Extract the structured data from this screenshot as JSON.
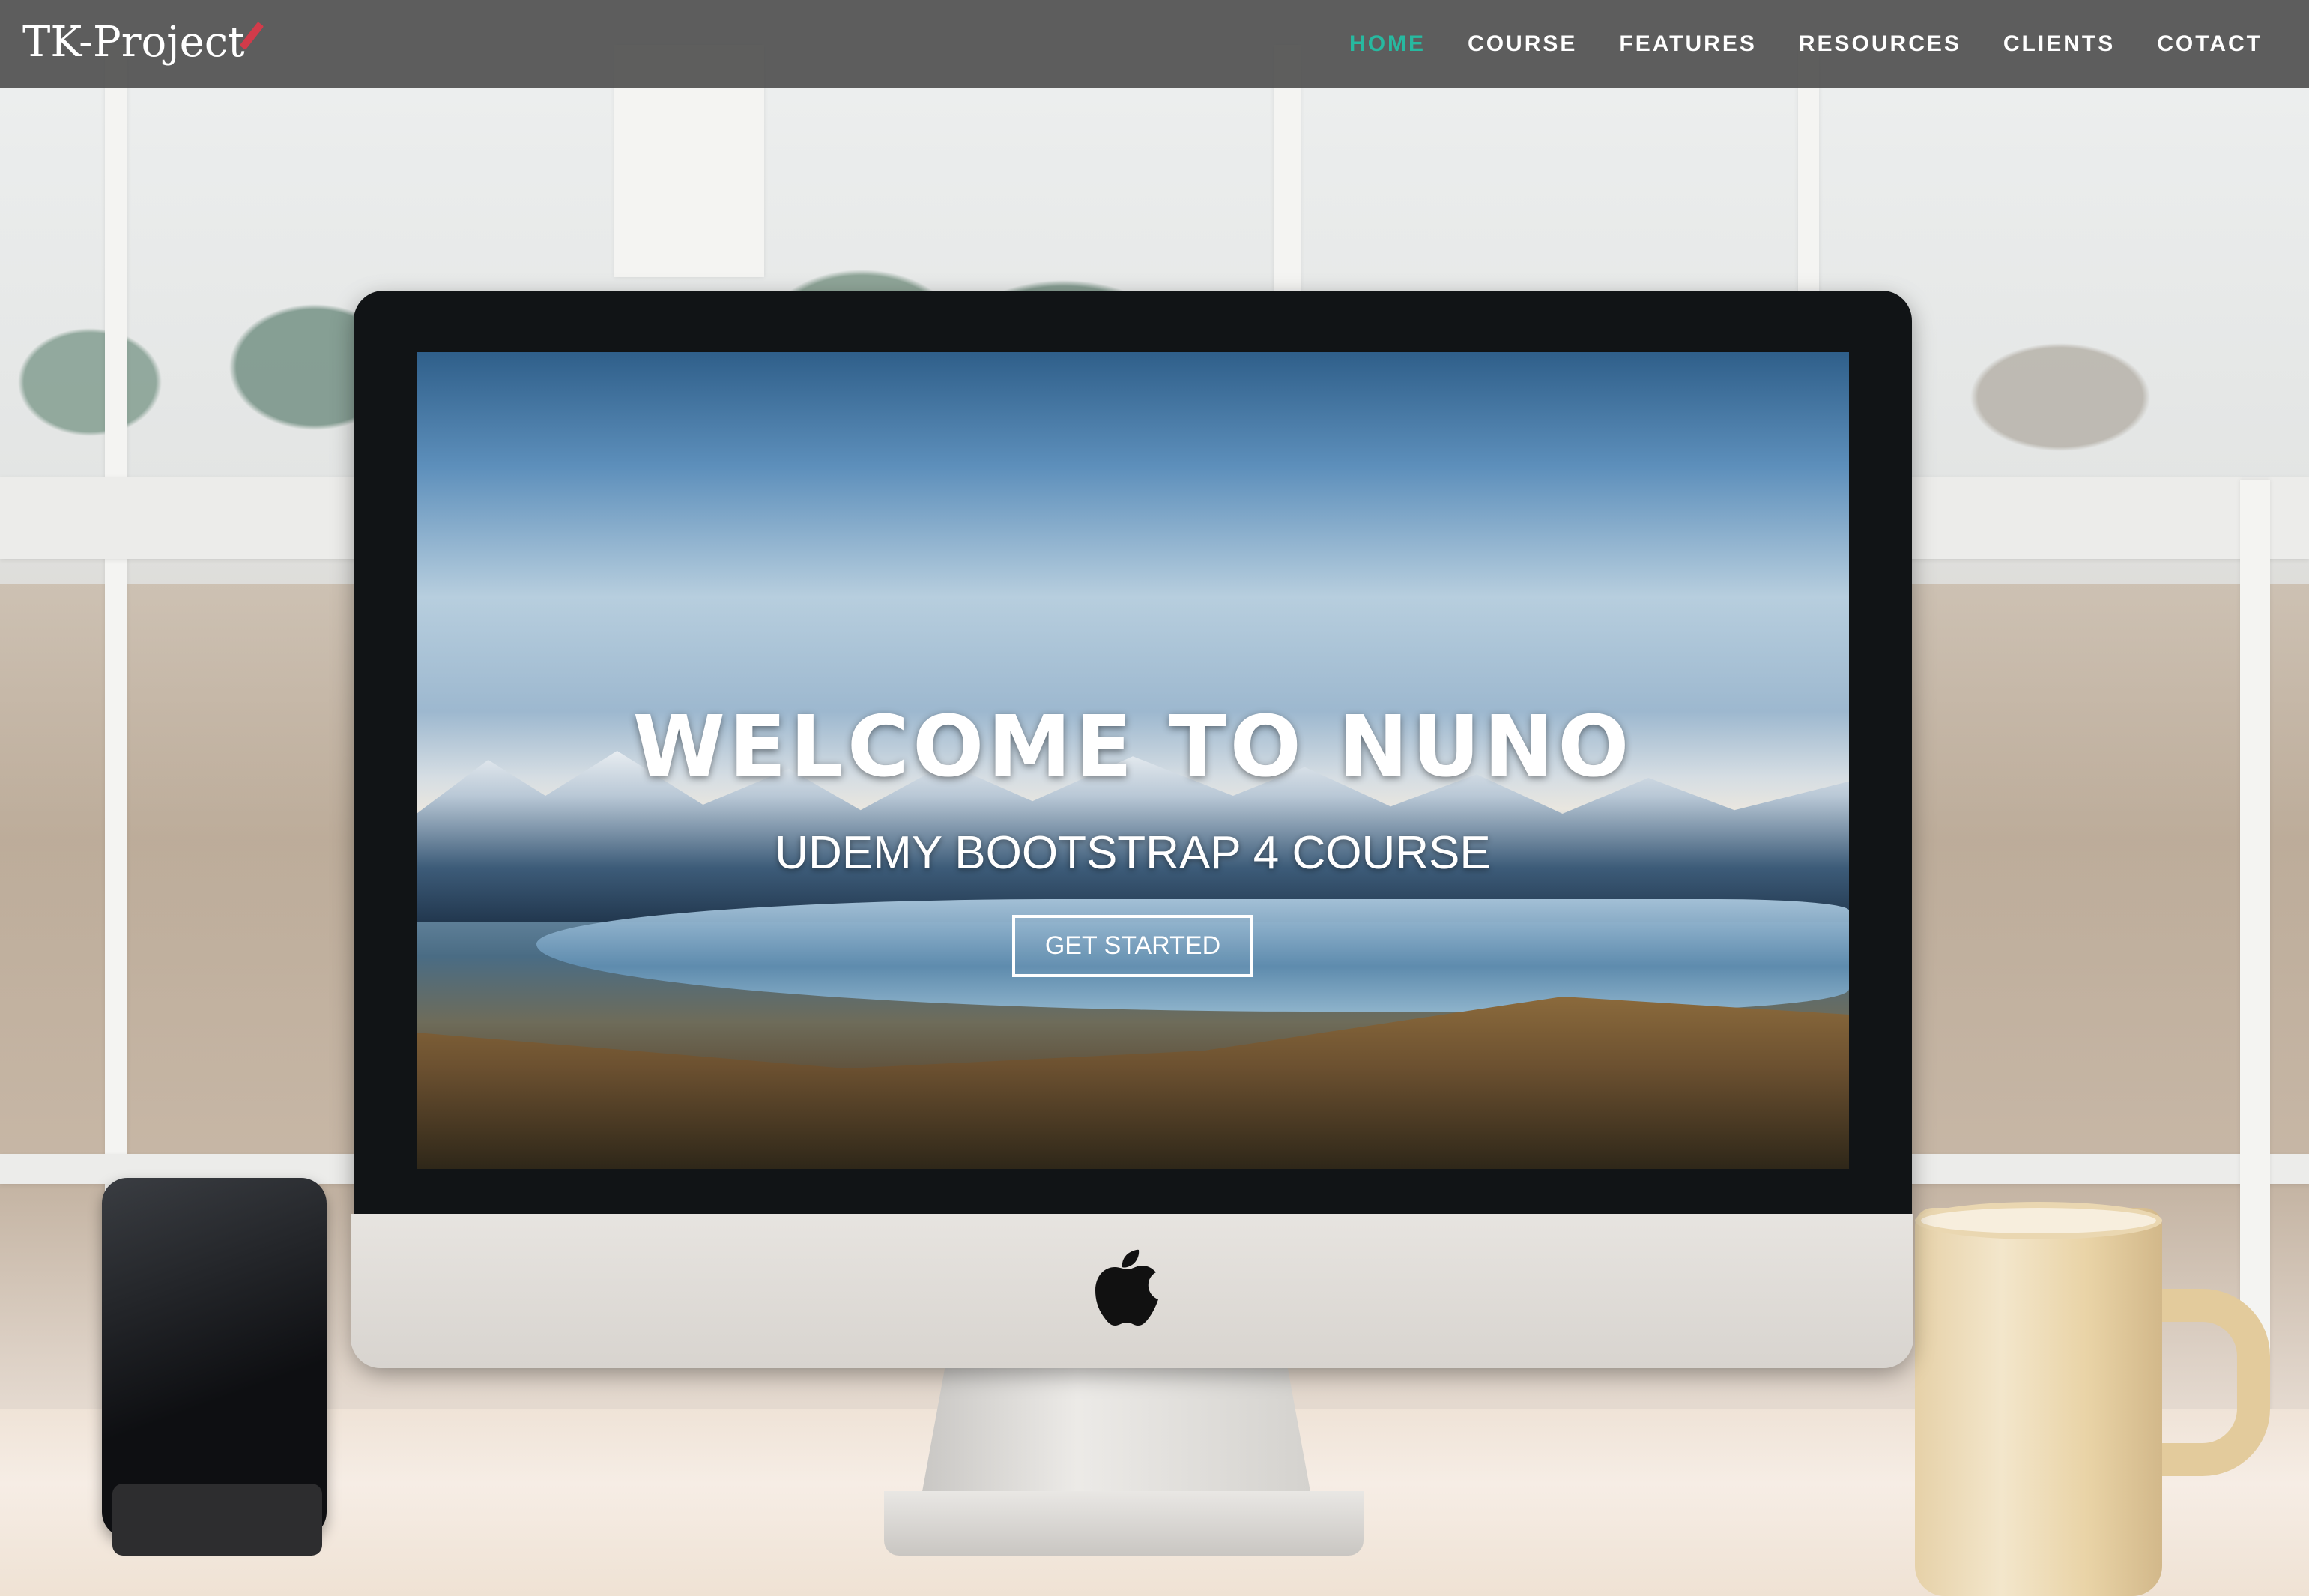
{
  "navbar": {
    "brand": "TK-Project",
    "items": [
      {
        "label": "HOME",
        "active": true
      },
      {
        "label": "COURSE"
      },
      {
        "label": "FEATURES"
      },
      {
        "label": "RESOURCES"
      },
      {
        "label": "CLIENTS"
      },
      {
        "label": "COTACT"
      }
    ]
  },
  "hero": {
    "title": "WELCOME TO NUNO",
    "subtitle": "UDEMY BOOTSTRAP 4 COURSE",
    "button": "GET STARTED"
  },
  "colors": {
    "navbar_bg": "#505050",
    "active_nav": "#27b9a0",
    "brand_accent": "#d23b4a",
    "text": "#ffffff"
  }
}
